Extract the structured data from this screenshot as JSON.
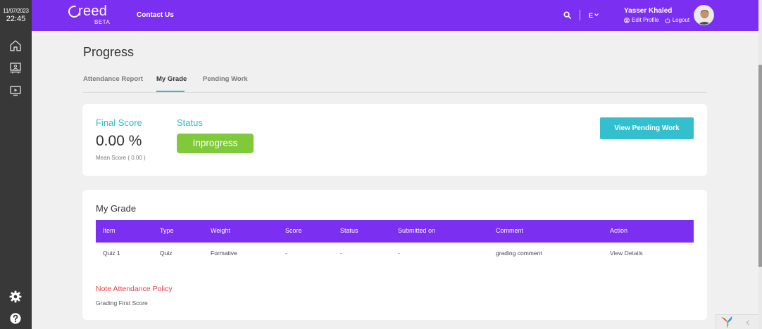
{
  "clock": {
    "date": "11/07/2023",
    "time": "22:45"
  },
  "brand": {
    "name": "reed",
    "tag": "BETA"
  },
  "nav": {
    "contact": "Contact Us",
    "language": "E"
  },
  "user": {
    "name": "Yasser Khaled",
    "edit_profile": "Edit Profile",
    "logout": "Logout"
  },
  "page": {
    "title": "Progress"
  },
  "tabs": [
    {
      "label": "Attendance Report"
    },
    {
      "label": "My Grade"
    },
    {
      "label": "Pending Work"
    }
  ],
  "summary": {
    "final_score_label": "Final Score",
    "final_score_value": "0.00 %",
    "mean_score": "Mean Score ( 0.00 )",
    "status_label": "Status",
    "status_value": "Inprogress",
    "pending_button": "View Pending Work"
  },
  "grades": {
    "title": "My Grade",
    "columns": [
      "Item",
      "Type",
      "Weight",
      "Score",
      "Status",
      "Submitted on",
      "Comment",
      "Action"
    ],
    "rows": [
      [
        "Quiz 1",
        "Quiz",
        "Formative",
        "-",
        "-",
        "-",
        "grading comment",
        "View Details"
      ]
    ]
  },
  "note": {
    "title": "Note Attendance Policy",
    "text": "Grading First Score"
  },
  "colors": {
    "primary": "#7b2ff0",
    "accent": "#2bbdcb",
    "success": "#80c93b",
    "danger": "#e5434e",
    "sidebar": "#383838"
  },
  "icons": [
    "search-icon",
    "chevron-down-icon",
    "user-circle-icon",
    "power-icon",
    "home-icon",
    "classroom-icon",
    "video-icon",
    "gear-icon",
    "help-icon"
  ]
}
